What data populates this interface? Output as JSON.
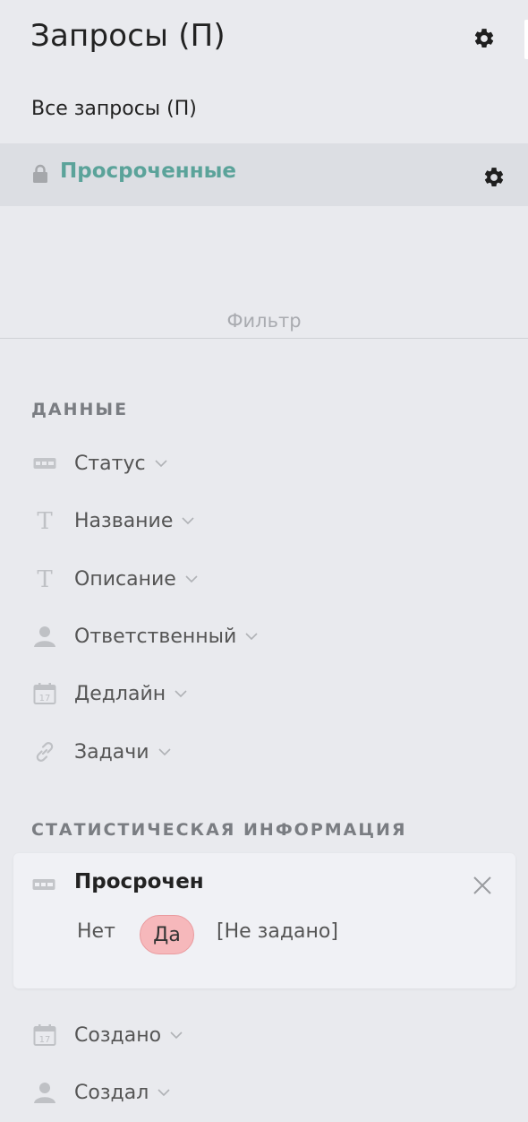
{
  "header": {
    "title": "Запросы (П)",
    "all_requests": "Все запросы (П)"
  },
  "selected_view": {
    "label": "Просроченные"
  },
  "filter": {
    "label": "Фильтр"
  },
  "sections": {
    "data": {
      "heading": "ДАННЫЕ",
      "fields": [
        {
          "label": "Статус",
          "icon": "list-icon"
        },
        {
          "label": "Название",
          "icon": "text-icon"
        },
        {
          "label": "Описание",
          "icon": "text-icon"
        },
        {
          "label": "Ответственный",
          "icon": "user-icon"
        },
        {
          "label": "Дедлайн",
          "icon": "calendar-icon"
        },
        {
          "label": "Задачи",
          "icon": "link-icon"
        }
      ]
    },
    "stats": {
      "heading": "СТАТИСТИЧЕСКАЯ ИНФОРМАЦИЯ",
      "active_filter": {
        "label": "Просрочен",
        "options": [
          "Нет",
          "Да",
          "[Не задано]"
        ],
        "selected": "Да"
      },
      "fields": [
        {
          "label": "Создано",
          "icon": "calendar-icon"
        },
        {
          "label": "Создал",
          "icon": "user-icon"
        }
      ]
    }
  },
  "colors": {
    "background": "#e9eaee",
    "selected_row": "#dcdee3",
    "accent_teal": "#5ba39a",
    "chip_pink": "#f6b8bb"
  }
}
